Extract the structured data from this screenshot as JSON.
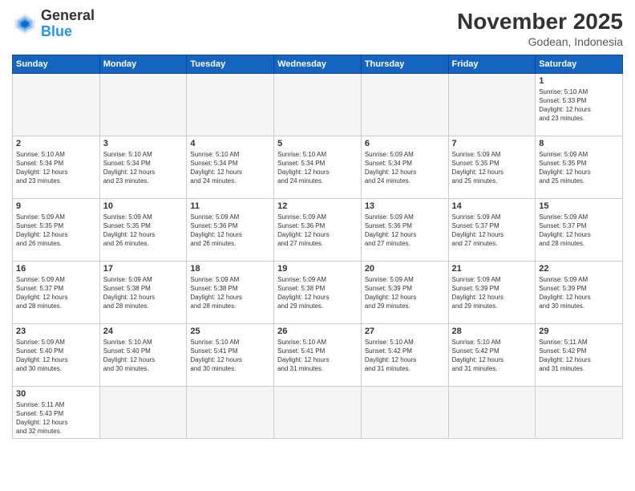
{
  "logo": {
    "general": "General",
    "blue": "Blue"
  },
  "header": {
    "month_year": "November 2025",
    "location": "Godean, Indonesia"
  },
  "weekdays": [
    "Sunday",
    "Monday",
    "Tuesday",
    "Wednesday",
    "Thursday",
    "Friday",
    "Saturday"
  ],
  "weeks": [
    [
      {
        "day": "",
        "info": ""
      },
      {
        "day": "",
        "info": ""
      },
      {
        "day": "",
        "info": ""
      },
      {
        "day": "",
        "info": ""
      },
      {
        "day": "",
        "info": ""
      },
      {
        "day": "",
        "info": ""
      },
      {
        "day": "1",
        "info": "Sunrise: 5:10 AM\nSunset: 5:33 PM\nDaylight: 12 hours\nand 23 minutes."
      }
    ],
    [
      {
        "day": "2",
        "info": "Sunrise: 5:10 AM\nSunset: 5:34 PM\nDaylight: 12 hours\nand 23 minutes."
      },
      {
        "day": "3",
        "info": "Sunrise: 5:10 AM\nSunset: 5:34 PM\nDaylight: 12 hours\nand 23 minutes."
      },
      {
        "day": "4",
        "info": "Sunrise: 5:10 AM\nSunset: 5:34 PM\nDaylight: 12 hours\nand 24 minutes."
      },
      {
        "day": "5",
        "info": "Sunrise: 5:10 AM\nSunset: 5:34 PM\nDaylight: 12 hours\nand 24 minutes."
      },
      {
        "day": "6",
        "info": "Sunrise: 5:09 AM\nSunset: 5:34 PM\nDaylight: 12 hours\nand 24 minutes."
      },
      {
        "day": "7",
        "info": "Sunrise: 5:09 AM\nSunset: 5:35 PM\nDaylight: 12 hours\nand 25 minutes."
      },
      {
        "day": "8",
        "info": "Sunrise: 5:09 AM\nSunset: 5:35 PM\nDaylight: 12 hours\nand 25 minutes."
      }
    ],
    [
      {
        "day": "9",
        "info": "Sunrise: 5:09 AM\nSunset: 5:35 PM\nDaylight: 12 hours\nand 26 minutes."
      },
      {
        "day": "10",
        "info": "Sunrise: 5:09 AM\nSunset: 5:35 PM\nDaylight: 12 hours\nand 26 minutes."
      },
      {
        "day": "11",
        "info": "Sunrise: 5:09 AM\nSunset: 5:36 PM\nDaylight: 12 hours\nand 26 minutes."
      },
      {
        "day": "12",
        "info": "Sunrise: 5:09 AM\nSunset: 5:36 PM\nDaylight: 12 hours\nand 27 minutes."
      },
      {
        "day": "13",
        "info": "Sunrise: 5:09 AM\nSunset: 5:36 PM\nDaylight: 12 hours\nand 27 minutes."
      },
      {
        "day": "14",
        "info": "Sunrise: 5:09 AM\nSunset: 5:37 PM\nDaylight: 12 hours\nand 27 minutes."
      },
      {
        "day": "15",
        "info": "Sunrise: 5:09 AM\nSunset: 5:37 PM\nDaylight: 12 hours\nand 28 minutes."
      }
    ],
    [
      {
        "day": "16",
        "info": "Sunrise: 5:09 AM\nSunset: 5:37 PM\nDaylight: 12 hours\nand 28 minutes."
      },
      {
        "day": "17",
        "info": "Sunrise: 5:09 AM\nSunset: 5:38 PM\nDaylight: 12 hours\nand 28 minutes."
      },
      {
        "day": "18",
        "info": "Sunrise: 5:09 AM\nSunset: 5:38 PM\nDaylight: 12 hours\nand 28 minutes."
      },
      {
        "day": "19",
        "info": "Sunrise: 5:09 AM\nSunset: 5:38 PM\nDaylight: 12 hours\nand 29 minutes."
      },
      {
        "day": "20",
        "info": "Sunrise: 5:09 AM\nSunset: 5:39 PM\nDaylight: 12 hours\nand 29 minutes."
      },
      {
        "day": "21",
        "info": "Sunrise: 5:09 AM\nSunset: 5:39 PM\nDaylight: 12 hours\nand 29 minutes."
      },
      {
        "day": "22",
        "info": "Sunrise: 5:09 AM\nSunset: 5:39 PM\nDaylight: 12 hours\nand 30 minutes."
      }
    ],
    [
      {
        "day": "23",
        "info": "Sunrise: 5:09 AM\nSunset: 5:40 PM\nDaylight: 12 hours\nand 30 minutes."
      },
      {
        "day": "24",
        "info": "Sunrise: 5:10 AM\nSunset: 5:40 PM\nDaylight: 12 hours\nand 30 minutes."
      },
      {
        "day": "25",
        "info": "Sunrise: 5:10 AM\nSunset: 5:41 PM\nDaylight: 12 hours\nand 30 minutes."
      },
      {
        "day": "26",
        "info": "Sunrise: 5:10 AM\nSunset: 5:41 PM\nDaylight: 12 hours\nand 31 minutes."
      },
      {
        "day": "27",
        "info": "Sunrise: 5:10 AM\nSunset: 5:42 PM\nDaylight: 12 hours\nand 31 minutes."
      },
      {
        "day": "28",
        "info": "Sunrise: 5:10 AM\nSunset: 5:42 PM\nDaylight: 12 hours\nand 31 minutes."
      },
      {
        "day": "29",
        "info": "Sunrise: 5:11 AM\nSunset: 5:42 PM\nDaylight: 12 hours\nand 31 minutes."
      }
    ],
    [
      {
        "day": "30",
        "info": "Sunrise: 5:11 AM\nSunset: 5:43 PM\nDaylight: 12 hours\nand 32 minutes."
      },
      {
        "day": "",
        "info": ""
      },
      {
        "day": "",
        "info": ""
      },
      {
        "day": "",
        "info": ""
      },
      {
        "day": "",
        "info": ""
      },
      {
        "day": "",
        "info": ""
      },
      {
        "day": "",
        "info": ""
      }
    ]
  ]
}
